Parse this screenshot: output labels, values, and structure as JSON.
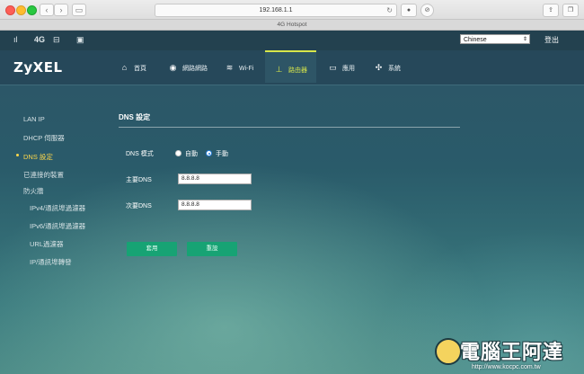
{
  "browser": {
    "url": "192.168.1.1",
    "page_title": "4G Hotspot",
    "reload_icon": "reload-icon"
  },
  "topbar": {
    "network": "4G",
    "language": "Chinese",
    "logout": "登出"
  },
  "brand": {
    "logo": "ZyXEL"
  },
  "tabs": [
    {
      "label": "首頁",
      "icon": "home-icon"
    },
    {
      "label": "網路網路",
      "icon": "globe-icon"
    },
    {
      "label": "Wi-Fi",
      "icon": "wifi-icon"
    },
    {
      "label": "路由器",
      "icon": "router-icon"
    },
    {
      "label": "應用",
      "icon": "monitor-icon"
    },
    {
      "label": "系統",
      "icon": "gear-icon"
    }
  ],
  "sidebar": {
    "items": [
      {
        "label": "LAN IP"
      },
      {
        "label": "DHCP 伺服器"
      },
      {
        "label": "DNS 設定"
      },
      {
        "label": "已連接的裝置"
      },
      {
        "label": "防火牆"
      },
      {
        "label": "IPv4/通訊埠過濾器"
      },
      {
        "label": "IPv6/通訊埠過濾器"
      },
      {
        "label": "URL過濾器"
      },
      {
        "label": "IP/通訊埠轉發"
      }
    ]
  },
  "main": {
    "title": "DNS 設定",
    "dns_mode_label": "DNS 模式",
    "mode_auto": "自動",
    "mode_manual": "手動",
    "primary_label": "主要DNS",
    "primary_value": "8.8.8.8",
    "secondary_label": "次要DNS",
    "secondary_value": "8.8.8.8",
    "apply_button": "套用",
    "reset_button": "重設"
  },
  "watermark": {
    "text": "電腦王阿達",
    "url": "http://www.kocpc.com.tw"
  }
}
